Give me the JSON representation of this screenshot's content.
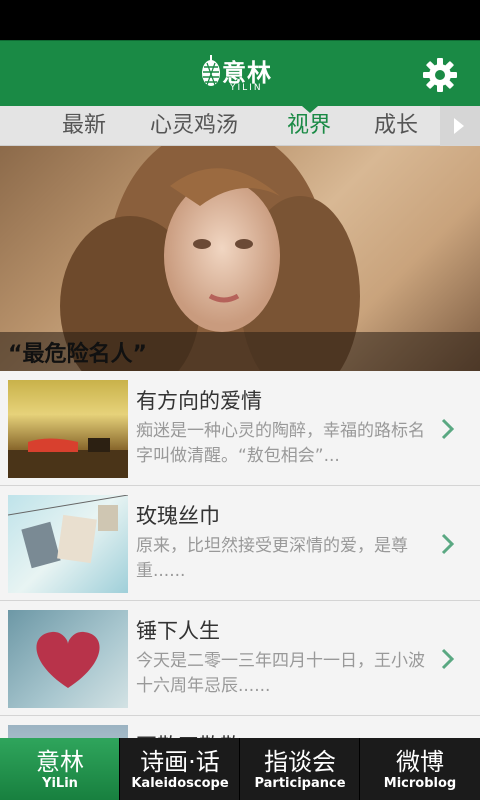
{
  "header": {
    "brand": "意林",
    "brand_en": "YILIN"
  },
  "tabs": [
    {
      "label": "最新"
    },
    {
      "label": "心灵鸡汤"
    },
    {
      "label": "视界"
    },
    {
      "label": "成长"
    }
  ],
  "hero": {
    "caption": "“最危险名人”"
  },
  "articles": [
    {
      "title": "有方向的爱情",
      "desc": "痴迷是一种心灵的陶醉，幸福的路标名字叫做清醒。“敖包相会”..."
    },
    {
      "title": "玫瑰丝巾",
      "desc": "原来，比坦然接受更深情的爱，是尊重......"
    },
    {
      "title": "锤下人生",
      "desc": "今天是二零一三年四月十一日，王小波十六周年忌辰......"
    },
    {
      "title": "不散四散散"
    }
  ],
  "bottom_nav": [
    {
      "cn": "意林",
      "en": "YiLin"
    },
    {
      "cn": "诗画·话",
      "en": "Kaleidoscope"
    },
    {
      "cn": "指谈会",
      "en": "Participance"
    },
    {
      "cn": "微博",
      "en": "Microblog"
    }
  ],
  "colors": {
    "primary_green": "#1a8a45",
    "active_tab": "#1a8a45",
    "chevron": "#5aa882"
  },
  "icons": {
    "settings": "gear-icon",
    "more_tabs": "chevron-right-icon"
  }
}
